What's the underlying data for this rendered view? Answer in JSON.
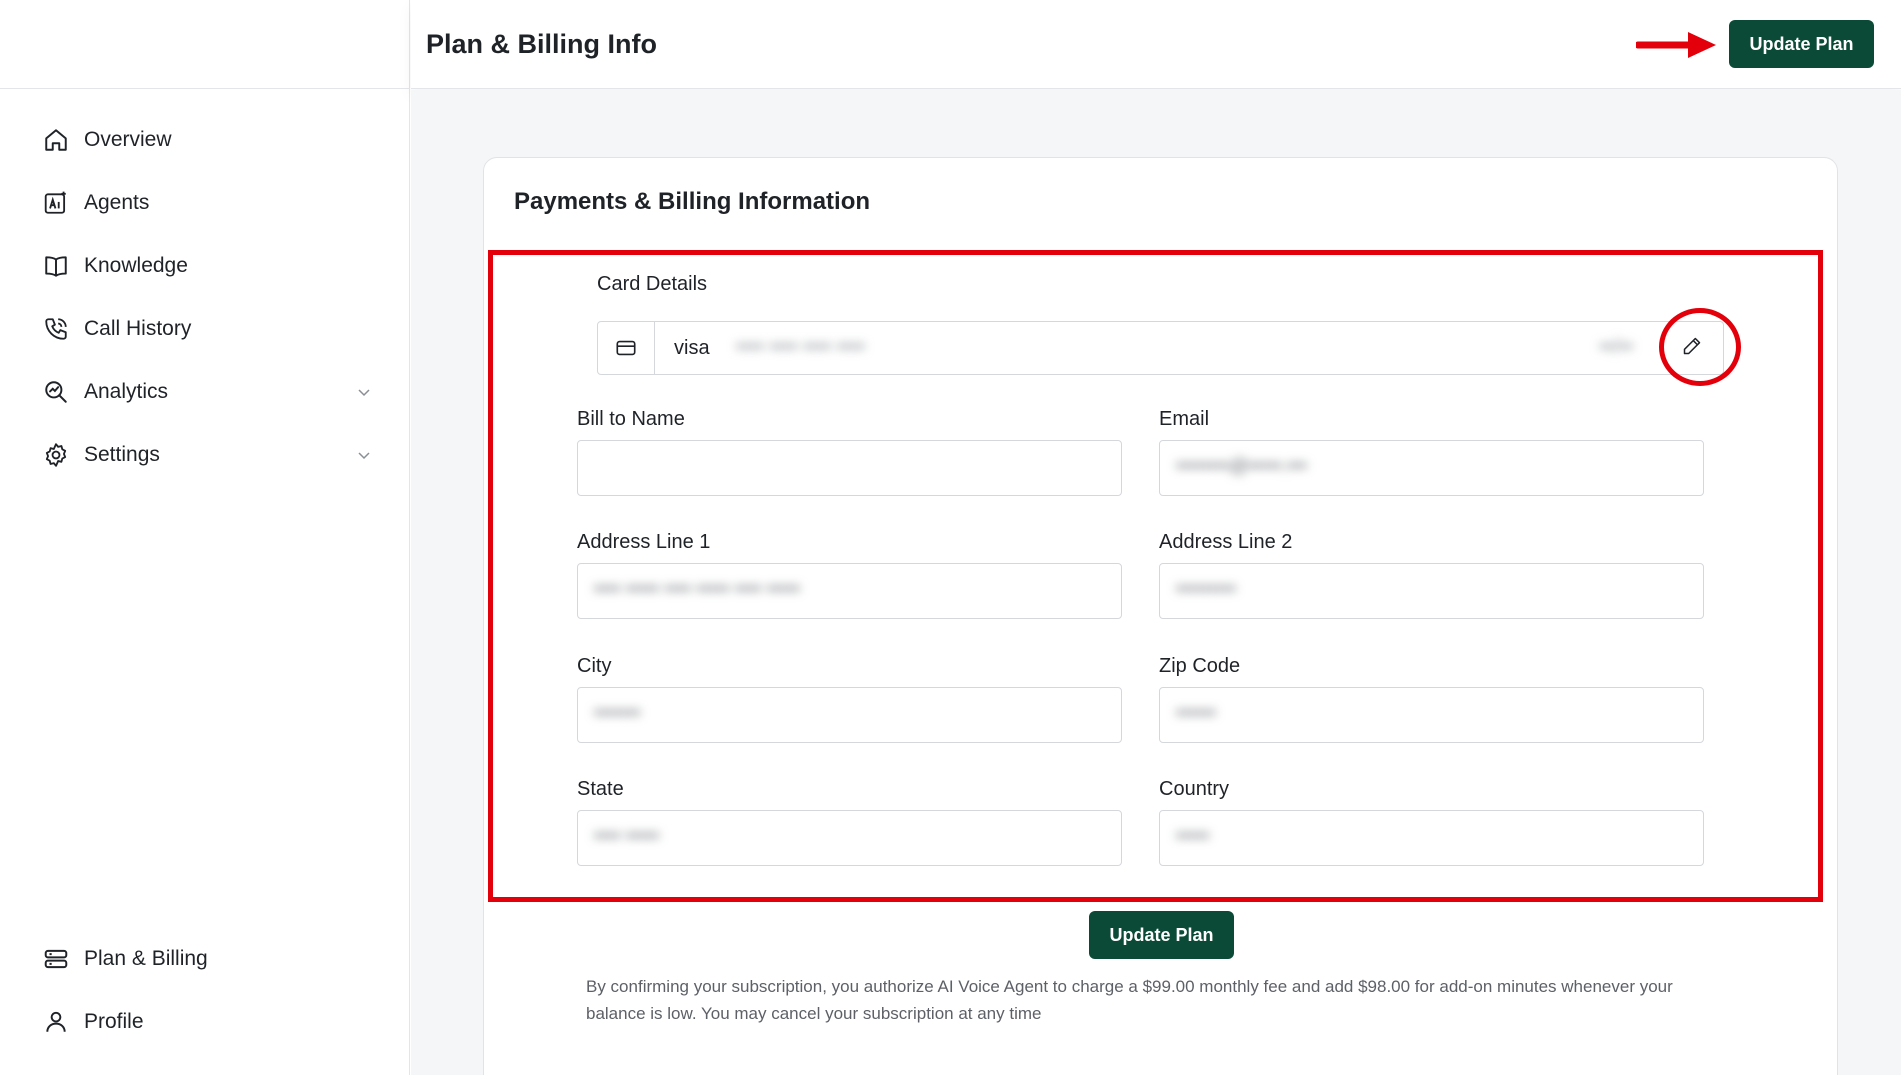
{
  "header": {
    "title": "Plan & Billing Info",
    "update_plan_label": "Update Plan",
    "arrow_color": "#e3000b"
  },
  "sidebar": {
    "items": [
      {
        "label": "Overview",
        "icon": "home-icon"
      },
      {
        "label": "Agents",
        "icon": "ai-agent-icon"
      },
      {
        "label": "Knowledge",
        "icon": "book-icon"
      },
      {
        "label": "Call History",
        "icon": "phone-call-icon"
      },
      {
        "label": "Analytics",
        "icon": "analytics-icon",
        "expandable": true
      },
      {
        "label": "Settings",
        "icon": "gear-icon",
        "expandable": true
      }
    ],
    "bottom_items": [
      {
        "label": "Plan & Billing",
        "icon": "billing-stack-icon"
      },
      {
        "label": "Profile",
        "icon": "user-icon"
      }
    ]
  },
  "card": {
    "title": "Payments & Billing Information",
    "card_details": {
      "label": "Card Details",
      "brand": "visa",
      "masked_number": "•••• •••• •••• ••••",
      "expiry": "••/••"
    },
    "fields": {
      "bill_to_name": {
        "label": "Bill to Name",
        "value": ""
      },
      "email": {
        "label": "Email",
        "value": "••••••••@•••••.•••"
      },
      "address_line_1": {
        "label": "Address Line 1",
        "value": "•••• ••••• •••• ••••• •••• •••••"
      },
      "address_line_2": {
        "label": "Address Line 2",
        "value": "•••••••••"
      },
      "city": {
        "label": "City",
        "value": "•••••••"
      },
      "zip_code": {
        "label": "Zip Code",
        "value": "••••••"
      },
      "state": {
        "label": "State",
        "value": "•••• •••••"
      },
      "country": {
        "label": "Country",
        "value": "•••••"
      }
    },
    "update_plan_label": "Update Plan",
    "legal_text": "By confirming your subscription, you authorize AI Voice Agent to charge a $99.00 monthly fee and add $98.00 for add-on minutes whenever your balance is low. You may cancel your subscription at any time"
  },
  "colors": {
    "accent": "#0b4a36",
    "highlight": "#e3000b"
  }
}
